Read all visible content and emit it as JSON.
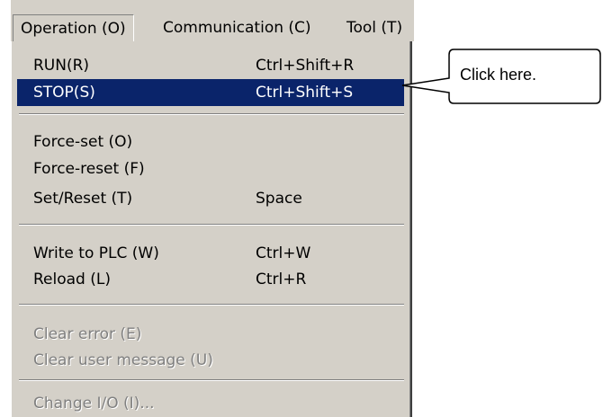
{
  "menubar": {
    "items": [
      {
        "label": "Operation (O)",
        "active": true
      },
      {
        "label": "Communication (C)",
        "active": false
      },
      {
        "label": "Tool (T)",
        "active": false
      }
    ]
  },
  "menu": {
    "items": [
      {
        "label": "RUN(R)",
        "shortcut": "Ctrl+Shift+R",
        "state": "enabled"
      },
      {
        "label": "STOP(S)",
        "shortcut": "Ctrl+Shift+S",
        "state": "selected"
      },
      {
        "label": "Force-set (O)",
        "shortcut": "",
        "state": "enabled"
      },
      {
        "label": "Force-reset (F)",
        "shortcut": "",
        "state": "enabled"
      },
      {
        "label": "Set/Reset (T)",
        "shortcut": "Space",
        "state": "enabled"
      },
      {
        "label": "Write to PLC (W)",
        "shortcut": "Ctrl+W",
        "state": "enabled"
      },
      {
        "label": "Reload (L)",
        "shortcut": "Ctrl+R",
        "state": "enabled"
      },
      {
        "label": "Clear error (E)",
        "shortcut": "",
        "state": "disabled"
      },
      {
        "label": "Clear user message (U)",
        "shortcut": "",
        "state": "disabled"
      },
      {
        "label": "Change I/O (I)...",
        "shortcut": "",
        "state": "disabled"
      }
    ]
  },
  "callout": {
    "text": "Click here."
  },
  "colors": {
    "menu_bg": "#d4d0c8",
    "highlight": "#0a246a",
    "disabled_text": "#808080"
  }
}
